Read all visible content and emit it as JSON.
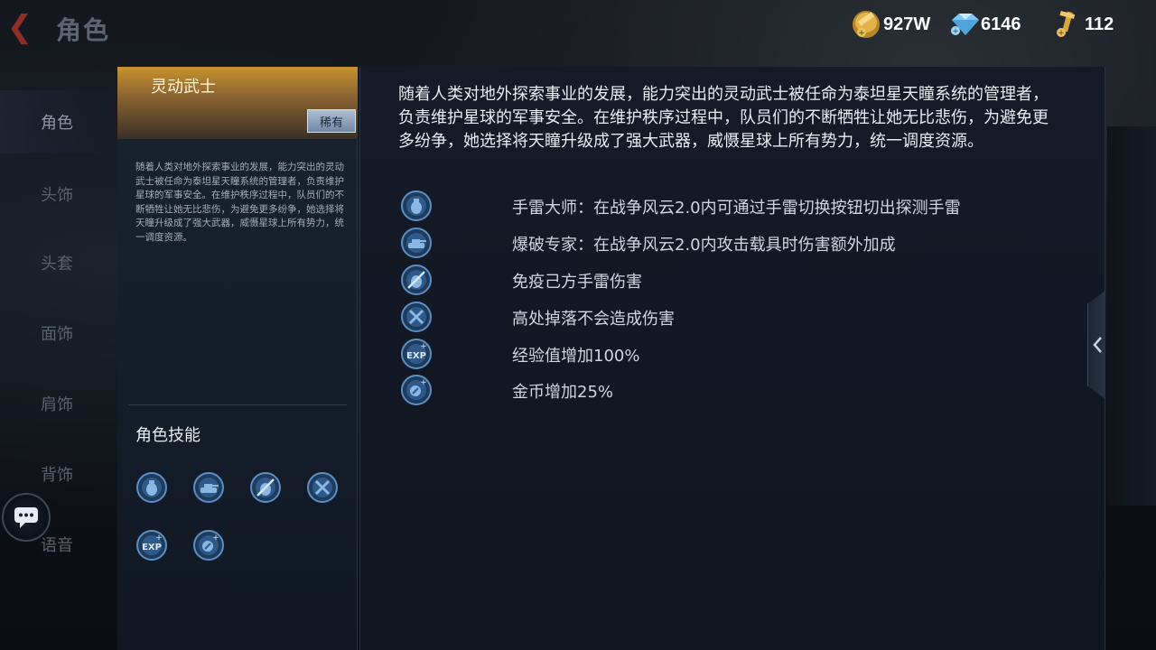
{
  "topbar": {
    "title": "角色",
    "currencies": [
      {
        "icon": "gold-coin-icon",
        "value": "927W"
      },
      {
        "icon": "diamond-icon",
        "value": "6146"
      },
      {
        "icon": "key-icon",
        "value": "112"
      }
    ]
  },
  "nav": {
    "items": [
      {
        "label": "角色",
        "active": true
      },
      {
        "label": "头饰",
        "active": false
      },
      {
        "label": "头套",
        "active": false
      },
      {
        "label": "面饰",
        "active": false
      },
      {
        "label": "肩饰",
        "active": false
      },
      {
        "label": "背饰",
        "active": false
      },
      {
        "label": "语音",
        "active": false
      }
    ]
  },
  "character": {
    "name": "灵动武士",
    "rarity": "稀有",
    "description": "随着人类对地外探索事业的发展，能力突出的灵动武士被任命为泰坦星天瞳系统的管理者，负责维护星球的军事安全。在维护秩序过程中，队员们的不断牺牲让她无比悲伤，为避免更多纷争，她选择将天瞳升级成了强大武器，威慑星球上所有势力，统一调度资源。",
    "skills_title": "角色技能"
  },
  "detail": {
    "description": "随着人类对地外探索事业的发展，能力突出的灵动武士被任命为泰坦星天瞳系统的管理者，负责维护星球的军事安全。在维护秩序过程中，队员们的不断牺牲让她无比悲伤，为避免更多纷争，她选择将天瞳升级成了强大武器，威慑星球上所有势力，统一调度资源。",
    "skills": [
      {
        "icon": "grenade-icon",
        "text": "手雷大师：在战争风云2.0内可通过手雷切换按钮切出探测手雷"
      },
      {
        "icon": "vehicle-icon",
        "text": "爆破专家：在战争风云2.0内攻击载具时伤害额外加成"
      },
      {
        "icon": "grenade-immune-icon",
        "text": "免疫己方手雷伤害"
      },
      {
        "icon": "fall-immune-icon",
        "text": "高处掉落不会造成伤害"
      },
      {
        "icon": "exp-icon",
        "text": "经验值增加100%"
      },
      {
        "icon": "coin-bonus-icon",
        "text": "金币增加25%"
      }
    ]
  },
  "colors": {
    "accent_gold": "#c8922e",
    "skill_icon_ring": "#4f7fb3",
    "panel_bg": "#141b27"
  }
}
